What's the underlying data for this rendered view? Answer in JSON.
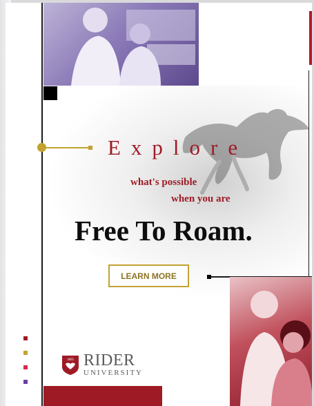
{
  "hero": {
    "explore": "Explore",
    "tagline_line1": "what's possible",
    "tagline_line2": "when you are",
    "headline": "Free To Roam."
  },
  "cta": {
    "label": "LEARN MORE"
  },
  "logo": {
    "seal_year": "1865",
    "name": "RIDER",
    "subtitle": "UNIVERSITY"
  },
  "images": {
    "top_photo": "students-in-lab-photo",
    "bottom_photo": "students-smiling-photo",
    "background": "horse-silhouette"
  },
  "colors": {
    "brand_red": "#9e1b26",
    "gold": "#c2a230",
    "purple_tint": "#8c7bb8",
    "red_tint": "#c0505c",
    "dot_colors": [
      "#9e1b26",
      "#c2a230",
      "#d62b4a",
      "#6b3fa0"
    ]
  }
}
